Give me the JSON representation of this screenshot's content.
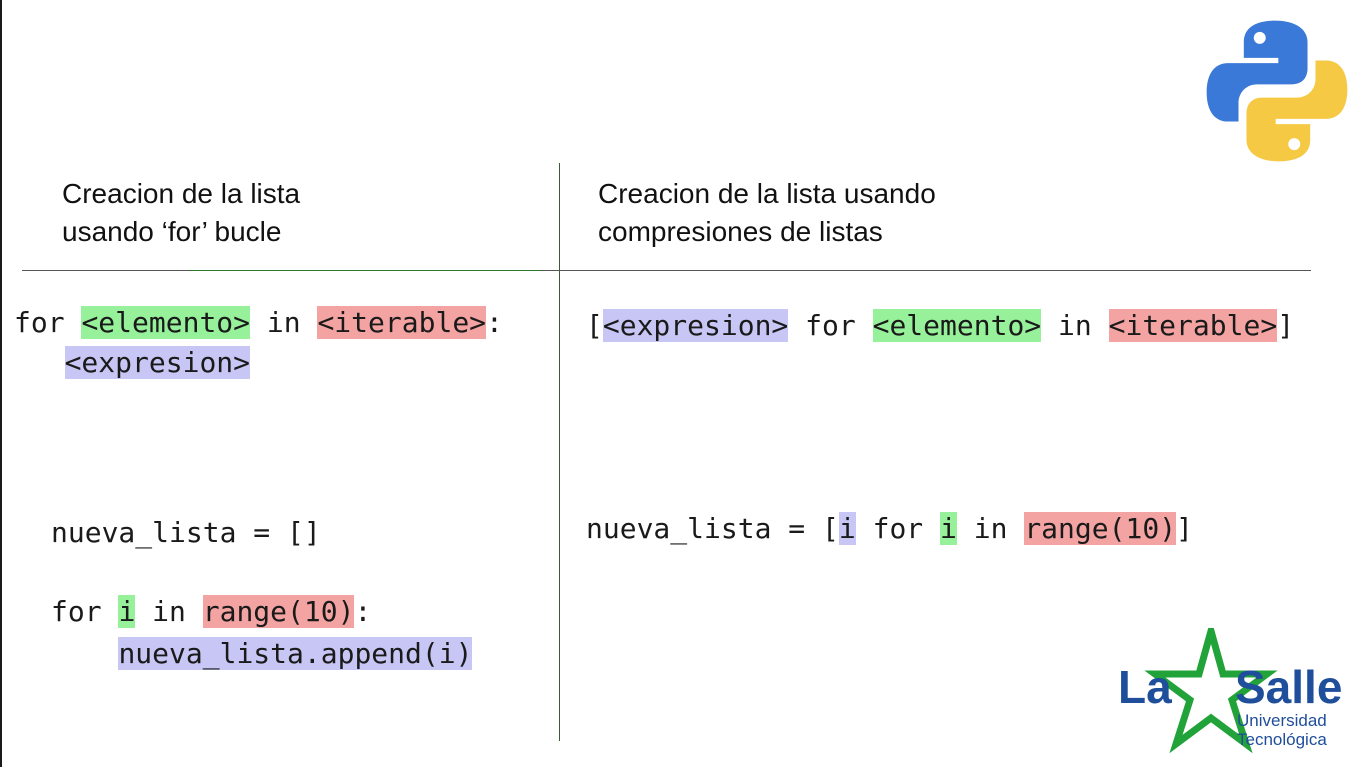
{
  "left": {
    "heading": [
      "Creacion de la lista",
      "usando ‘for’ bucle"
    ],
    "template": {
      "kw_for": "for ",
      "elemento": "<elemento>",
      "kw_in": " in ",
      "iterable": "<iterable>",
      "colon": ":",
      "indent": "   ",
      "expresion": "<expresion>"
    },
    "example": {
      "line1": "nueva_lista = []",
      "kw_for": "for ",
      "var": "i",
      "kw_in": " in ",
      "range": "range(10)",
      "colon": ":",
      "indent": "    ",
      "body": "nueva_lista.append(i)"
    }
  },
  "right": {
    "heading": [
      "Creacion de la lista usando",
      "compresiones de listas"
    ],
    "template": {
      "open": "[",
      "expresion": "<expresion>",
      "kw_for": " for ",
      "elemento": "<elemento>",
      "kw_in": " in ",
      "iterable": "<iterable>",
      "close": "]"
    },
    "example": {
      "prefix": "nueva_lista = [",
      "expr": "i",
      "kw_for": " for ",
      "var": "i",
      "kw_in": " in ",
      "range": "range(10)",
      "close": "]"
    }
  },
  "logo": {
    "brand_la": "La",
    "brand_salle": "Salle",
    "line1": "Universidad",
    "line2": "Tecnológica",
    "green": "#22a33a",
    "blue": "#1f4e9a"
  },
  "python_logo": {
    "blue": "#3a79d8",
    "yellow": "#f6c945"
  }
}
